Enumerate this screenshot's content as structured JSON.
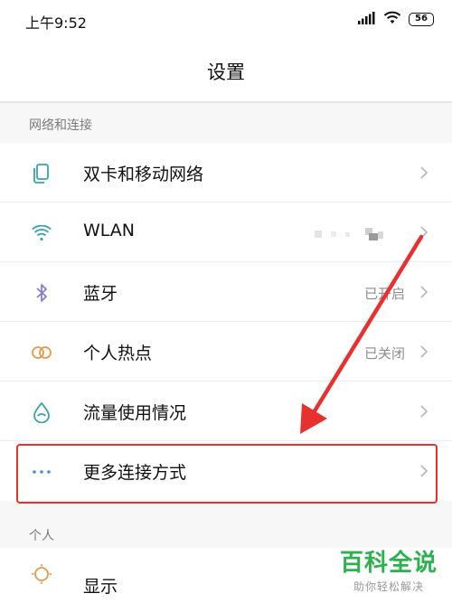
{
  "status_bar": {
    "time": "上午9:52",
    "battery": "56"
  },
  "header": {
    "title": "设置"
  },
  "sections": [
    {
      "label": "网络和连接",
      "items": [
        {
          "label": "双卡和移动网络",
          "value": "",
          "icon": "sim-card-icon"
        },
        {
          "label": "WLAN",
          "value": "",
          "icon": "wifi-icon"
        },
        {
          "label": "蓝牙",
          "value": "已开启",
          "icon": "bluetooth-icon"
        },
        {
          "label": "个人热点",
          "value": "已关闭",
          "icon": "hotspot-icon"
        },
        {
          "label": "流量使用情况",
          "value": "",
          "icon": "data-usage-icon"
        },
        {
          "label": "更多连接方式",
          "value": "",
          "icon": "more-dots-icon"
        }
      ]
    },
    {
      "label": "个人",
      "items": [
        {
          "label": "显示",
          "value": "",
          "icon": "display-icon"
        }
      ]
    }
  ],
  "watermark": {
    "title": "百科全说",
    "subtitle": "助你轻松解决"
  },
  "colors": {
    "icon_teal": "#3aa3a8",
    "icon_purple": "#8a7bd0",
    "icon_orange": "#e89a4a",
    "icon_blue": "#4a8fd6",
    "highlight_red": "#e8312f",
    "watermark_green": "#2bb24c"
  }
}
